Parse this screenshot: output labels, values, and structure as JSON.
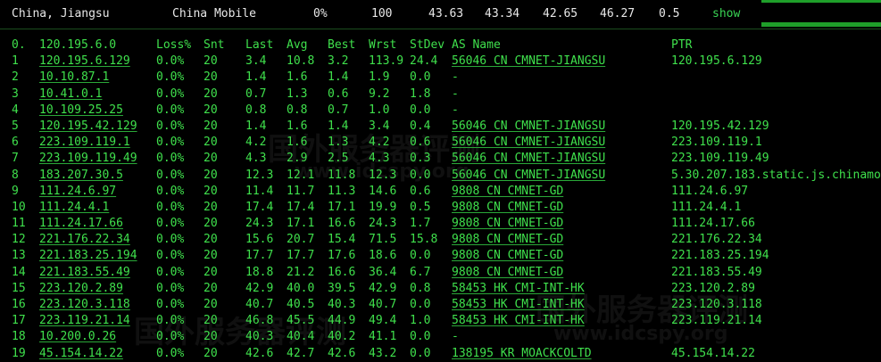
{
  "header": {
    "location": "China, Jiangsu",
    "isp": "China Mobile",
    "loss": "0%",
    "snt": "100",
    "last": "43.63",
    "avg": "43.34",
    "best": "42.65",
    "wrst": "46.27",
    "stdev": "0.5",
    "show_label": "show"
  },
  "columns": [
    "0.",
    "120.195.6.0",
    "Loss%",
    "Snt",
    "Last",
    "Avg",
    "Best",
    "Wrst",
    "StDev",
    "AS Name",
    "PTR"
  ],
  "rows": [
    [
      "1",
      "120.195.6.129",
      "0.0%",
      "20",
      "3.4",
      "10.8",
      "3.2",
      "113.9",
      "24.4",
      "56046 CN CMNET-JIANGSU",
      "120.195.6.129"
    ],
    [
      "2",
      "10.10.87.1",
      "0.0%",
      "20",
      "1.4",
      "1.6",
      "1.4",
      "1.9",
      "0.0",
      "-",
      ""
    ],
    [
      "3",
      "10.41.0.1",
      "0.0%",
      "20",
      "0.7",
      "1.3",
      "0.6",
      "9.2",
      "1.8",
      "-",
      ""
    ],
    [
      "4",
      "10.109.25.25",
      "0.0%",
      "20",
      "0.8",
      "0.8",
      "0.7",
      "1.0",
      "0.0",
      "-",
      ""
    ],
    [
      "5",
      "120.195.42.129",
      "0.0%",
      "20",
      "1.4",
      "1.6",
      "1.4",
      "3.4",
      "0.4",
      "56046 CN CMNET-JIANGSU",
      "120.195.42.129"
    ],
    [
      "6",
      "223.109.119.1",
      "0.0%",
      "20",
      "4.2",
      "1.6",
      "1.3",
      "4.2",
      "0.6",
      "56046 CN CMNET-JIANGSU",
      "223.109.119.1"
    ],
    [
      "7",
      "223.109.119.49",
      "0.0%",
      "20",
      "4.3",
      "2.9",
      "2.5",
      "4.3",
      "0.3",
      "56046 CN CMNET-JIANGSU",
      "223.109.119.49"
    ],
    [
      "8",
      "183.207.30.5",
      "0.0%",
      "20",
      "12.3",
      "12.1",
      "11.8",
      "12.3",
      "0.0",
      "56046 CN CMNET-JIANGSU",
      "5.30.207.183.static.js.chinamo"
    ],
    [
      "9",
      "111.24.6.97",
      "0.0%",
      "20",
      "11.4",
      "11.7",
      "11.3",
      "14.6",
      "0.6",
      "9808 CN CMNET-GD",
      "111.24.6.97"
    ],
    [
      "10",
      "111.24.4.1",
      "0.0%",
      "20",
      "17.4",
      "17.4",
      "17.1",
      "19.9",
      "0.5",
      "9808 CN CMNET-GD",
      "111.24.4.1"
    ],
    [
      "11",
      "111.24.17.66",
      "0.0%",
      "20",
      "24.3",
      "17.1",
      "16.6",
      "24.3",
      "1.7",
      "9808 CN CMNET-GD",
      "111.24.17.66"
    ],
    [
      "12",
      "221.176.22.34",
      "0.0%",
      "20",
      "15.6",
      "20.7",
      "15.4",
      "71.5",
      "15.8",
      "9808 CN CMNET-GD",
      "221.176.22.34"
    ],
    [
      "13",
      "221.183.25.194",
      "0.0%",
      "20",
      "17.7",
      "17.7",
      "17.6",
      "18.6",
      "0.0",
      "9808 CN CMNET-GD",
      "221.183.25.194"
    ],
    [
      "14",
      "221.183.55.49",
      "0.0%",
      "20",
      "18.8",
      "21.2",
      "16.6",
      "36.4",
      "6.7",
      "9808 CN CMNET-GD",
      "221.183.55.49"
    ],
    [
      "15",
      "223.120.2.89",
      "0.0%",
      "20",
      "42.9",
      "40.0",
      "39.5",
      "42.9",
      "0.8",
      "58453 HK CMI-INT-HK",
      "223.120.2.89"
    ],
    [
      "16",
      "223.120.3.118",
      "0.0%",
      "20",
      "40.7",
      "40.5",
      "40.3",
      "40.7",
      "0.0",
      "58453 HK CMI-INT-HK",
      "223.120.3.118"
    ],
    [
      "17",
      "223.119.21.14",
      "0.0%",
      "20",
      "46.8",
      "45.5",
      "44.9",
      "49.4",
      "1.0",
      "58453 HK CMI-INT-HK",
      "223.119.21.14"
    ],
    [
      "18",
      "10.200.0.26",
      "0.0%",
      "20",
      "40.3",
      "40.4",
      "40.2",
      "41.1",
      "0.0",
      "-",
      ""
    ],
    [
      "19",
      "45.154.14.22",
      "0.0%",
      "20",
      "42.6",
      "42.7",
      "42.6",
      "43.2",
      "0.0",
      "138195 KR MOACKCOLTD",
      "45.154.14.22"
    ]
  ],
  "watermark": {
    "text1": "国外服务器评测",
    "text2": "www.idcspy.org"
  }
}
